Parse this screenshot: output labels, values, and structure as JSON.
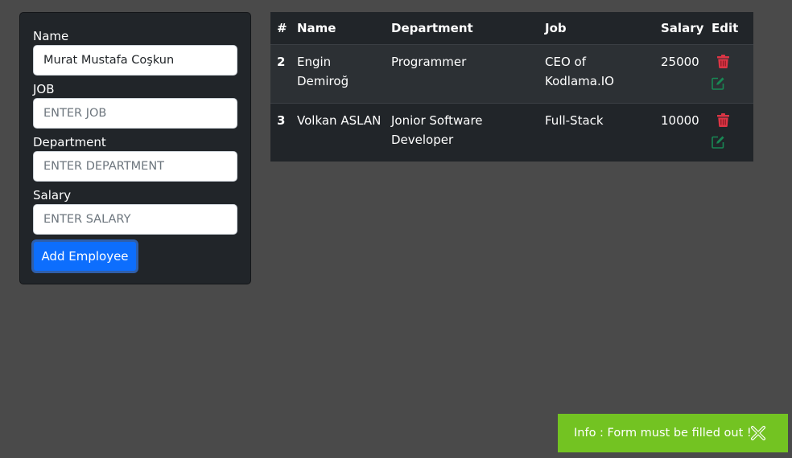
{
  "form": {
    "name_label": "Name",
    "name_value": "Murat Mustafa Coşkun",
    "job_label": "JOB",
    "job_placeholder": "ENTER JOB",
    "department_label": "Department",
    "department_placeholder": "ENTER DEPARTMENT",
    "salary_label": "Salary",
    "salary_placeholder": "ENTER SALARY",
    "submit_label": "Add Employee"
  },
  "table": {
    "headers": {
      "num": "#",
      "name": "Name",
      "department": "Department",
      "job": "Job",
      "salary": "Salary",
      "edit": "Edit"
    },
    "rows": [
      {
        "id": "2",
        "name": "Engin Demiroğ",
        "department": "Programmer",
        "job": "CEO of Kodlama.IO",
        "salary": "25000",
        "delete_icon": "trash-icon",
        "edit_icon": "edit-pen-icon"
      },
      {
        "id": "3",
        "name": "Volkan ASLAN",
        "department": "Jonior Software Developer",
        "job": "Full-Stack",
        "salary": "10000",
        "delete_icon": "trash-icon",
        "edit_icon": "edit-pen-icon"
      }
    ]
  },
  "toast": {
    "message": "Info : Form must be filled out !",
    "close_icon": "close-icon"
  },
  "colors": {
    "background": "#4a4a4a",
    "panel": "#212529",
    "primary": "#0d6efd",
    "danger": "#dc3545",
    "success": "#198754",
    "toast": "#73c322"
  }
}
